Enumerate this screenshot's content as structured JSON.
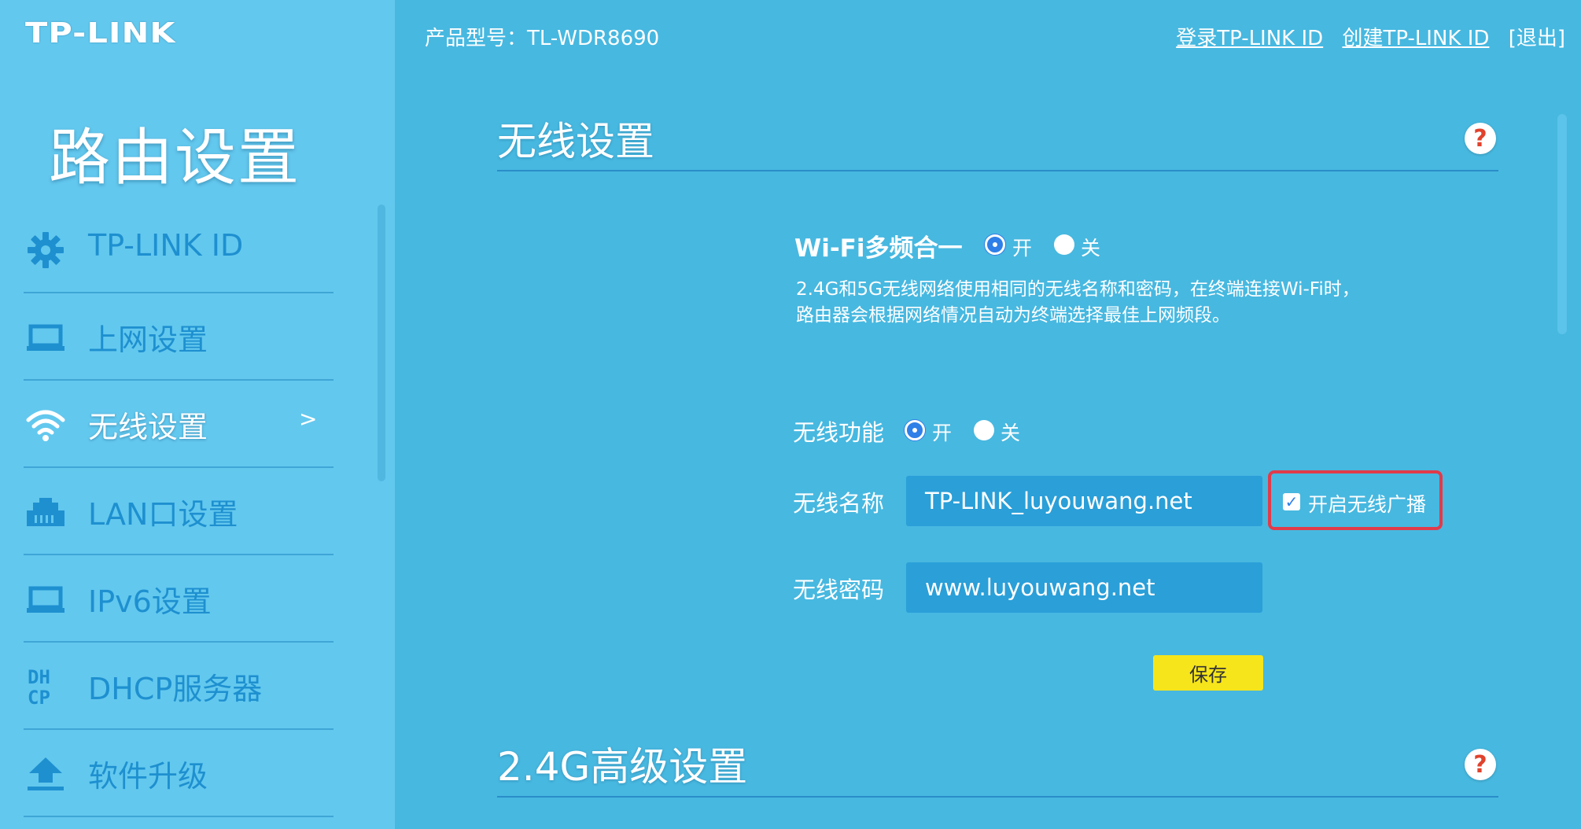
{
  "header": {
    "logo": "TP-LINK",
    "product_model": "产品型号：TL-WDR8690",
    "links": [
      "登录TP-LINK ID",
      "创建TP-LINK ID",
      "[退出]"
    ]
  },
  "sidebar": {
    "title": "路由设置",
    "items": [
      {
        "label": "TP-LINK ID",
        "icon": "gear-icon"
      },
      {
        "label": "上网设置",
        "icon": "laptop-icon"
      },
      {
        "label": "无线设置",
        "icon": "wifi-icon",
        "active": true,
        "arrow": ">"
      },
      {
        "label": "LAN口设置",
        "icon": "lan-port-icon"
      },
      {
        "label": "IPv6设置",
        "icon": "laptop-icon"
      },
      {
        "label": "DHCP服务器",
        "icon": "dhcp-icon"
      },
      {
        "label": "软件升级",
        "icon": "upload-icon"
      }
    ]
  },
  "main": {
    "wireless": {
      "title": "无线设置",
      "help": "?",
      "multiband": {
        "label": "Wi-Fi多频合一",
        "on": "开",
        "off": "关",
        "selected": "开",
        "desc_line1": "2.4G和5G无线网络使用相同的无线名称和密码，在终端连接Wi-Fi时，",
        "desc_line2": "路由器会根据网络情况自动为终端选择最佳上网频段。"
      },
      "function": {
        "label": "无线功能",
        "on": "开",
        "off": "关",
        "selected": "开"
      },
      "ssid": {
        "label": "无线名称",
        "value": "TP-LINK_luyouwang.net",
        "broadcast_label": "开启无线广播",
        "broadcast_checked": true
      },
      "password": {
        "label": "无线密码",
        "value": "www.luyouwang.net"
      },
      "save": "保存"
    },
    "advanced24": {
      "title": "2.4G高级设置",
      "help": "?"
    }
  },
  "colors": {
    "background": "#47b8e0",
    "sidebar": "#63c8ee",
    "save_button": "#f6e51b",
    "highlight_box": "#e13b4a",
    "radio_on": "#2f7fe8"
  }
}
